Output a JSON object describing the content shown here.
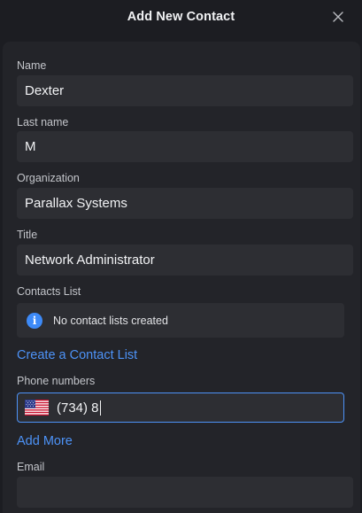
{
  "dialog": {
    "title": "Add New Contact",
    "close_icon": "close-icon"
  },
  "form": {
    "name": {
      "label": "Name",
      "value": "Dexter"
    },
    "last_name": {
      "label": "Last name",
      "value": "M"
    },
    "organization": {
      "label": "Organization",
      "value": "Parallax Systems"
    },
    "title": {
      "label": "Title",
      "value": "Network Administrator"
    },
    "contacts_list": {
      "label": "Contacts List",
      "info_icon": "info-icon",
      "message": "No contact lists created",
      "create_link": "Create a Contact List"
    },
    "phone": {
      "label": "Phone numbers",
      "country_flag": "us-flag-icon",
      "value": "(734) 8",
      "add_more_link": "Add More"
    },
    "email": {
      "label": "Email",
      "value": ""
    }
  },
  "colors": {
    "background": "#1c1d22",
    "panel": "#232429",
    "field": "#2d2e33",
    "accent": "#4d93f8"
  }
}
